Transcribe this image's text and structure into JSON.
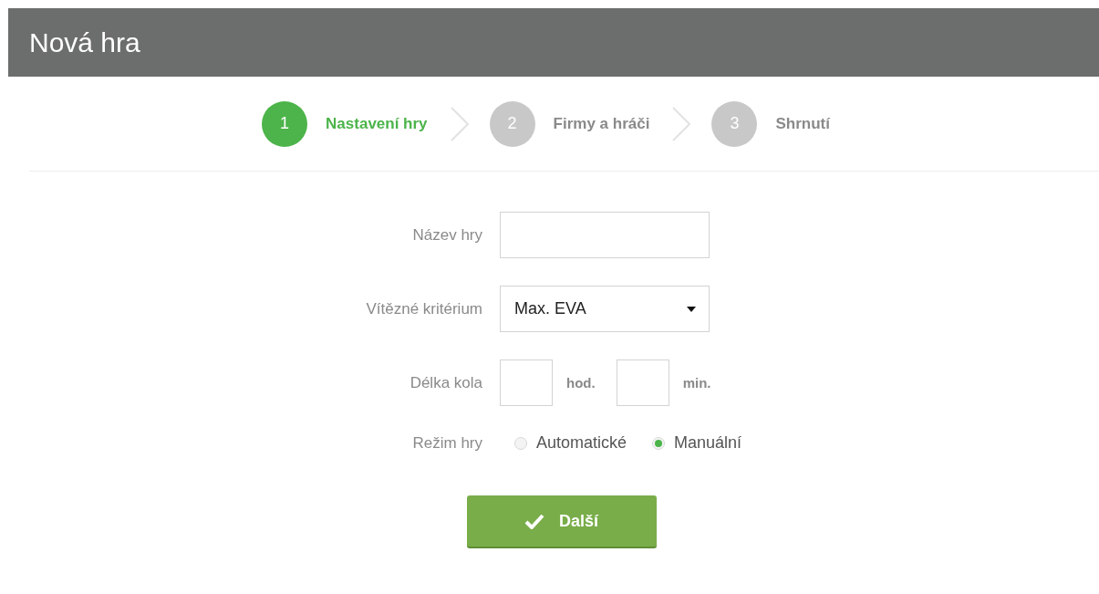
{
  "header": {
    "title": "Nová hra"
  },
  "steps": [
    {
      "number": "1",
      "label": "Nastavení hry",
      "selected": true
    },
    {
      "number": "2",
      "label": "Firmy a hráči",
      "selected": false
    },
    {
      "number": "3",
      "label": "Shrnutí",
      "selected": false
    }
  ],
  "form": {
    "name": {
      "label": "Název hry"
    },
    "criterion": {
      "label": "Vítězné kritérium",
      "value": "Max. EVA"
    },
    "duration": {
      "label": "Délka kola",
      "hours_unit": "hod.",
      "minutes_unit": "min."
    },
    "mode": {
      "label": "Režim hry",
      "options": [
        {
          "label": "Automatické",
          "selected": false
        },
        {
          "label": "Manuální",
          "selected": true
        }
      ]
    }
  },
  "next_button": {
    "label": "Další"
  }
}
